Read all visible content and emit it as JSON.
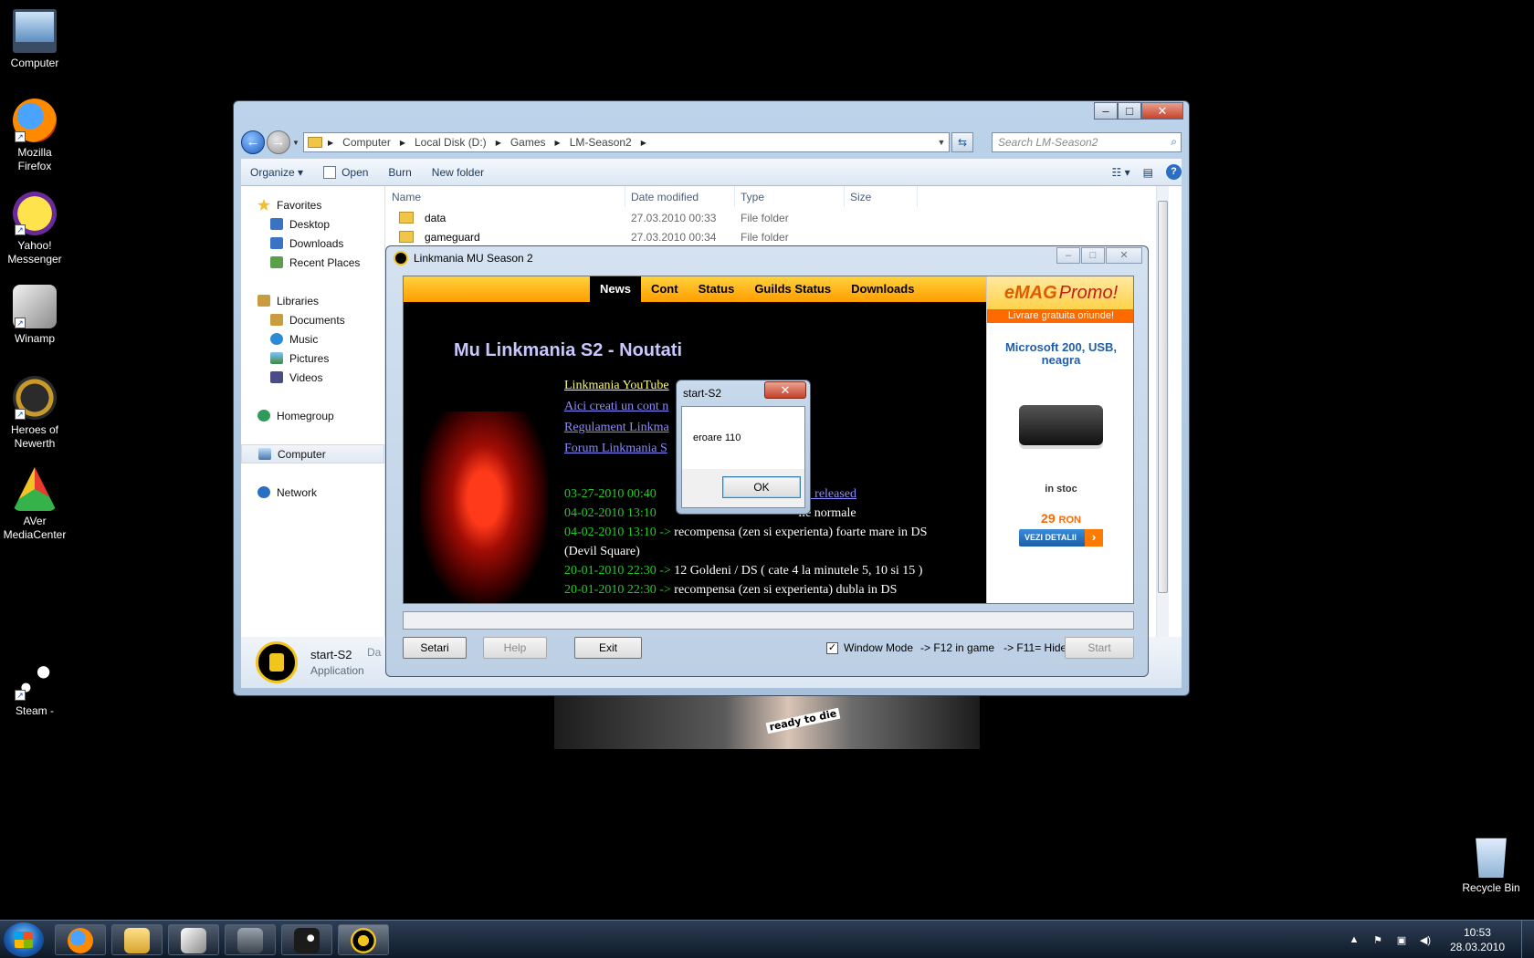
{
  "desktop": {
    "icons": [
      {
        "label": "Computer",
        "icon": "computer-icon"
      },
      {
        "label": "Mozilla Firefox",
        "icon": "firefox-icon"
      },
      {
        "label": "Yahoo! Messenger",
        "icon": "yahoo-messenger-icon"
      },
      {
        "label": "Winamp",
        "icon": "winamp-icon"
      },
      {
        "label": "Heroes of Newerth",
        "icon": "hon-icon"
      },
      {
        "label": "AVer MediaCenter",
        "icon": "aver-icon"
      },
      {
        "label": "Steam -",
        "icon": "steam-icon"
      },
      {
        "label": "Recycle Bin",
        "icon": "recycle-bin-icon"
      }
    ],
    "wallpaper_text": "ready to die"
  },
  "explorer": {
    "breadcrumb": [
      "Computer",
      "Local Disk (D:)",
      "Games",
      "LM-Season2"
    ],
    "search_placeholder": "Search LM-Season2",
    "toolbar": {
      "organize": "Organize",
      "open": "Open",
      "burn": "Burn",
      "new_folder": "New folder"
    },
    "nav": {
      "favorites": "Favorites",
      "desktop": "Desktop",
      "downloads": "Downloads",
      "recent": "Recent Places",
      "libraries": "Libraries",
      "documents": "Documents",
      "music": "Music",
      "pictures": "Pictures",
      "videos": "Videos",
      "homegroup": "Homegroup",
      "computer": "Computer",
      "network": "Network"
    },
    "columns": {
      "name": "Name",
      "date": "Date modified",
      "type": "Type",
      "size": "Size"
    },
    "files": [
      {
        "name": "data",
        "date": "27.03.2010 00:33",
        "type": "File folder"
      },
      {
        "name": "gameguard",
        "date": "27.03.2010 00:34",
        "type": "File folder"
      }
    ],
    "details": {
      "name": "start-S2",
      "type": "Application",
      "date_label": "Da"
    }
  },
  "launcher": {
    "title": "Linkmania MU Season 2",
    "nav": [
      "News",
      "Cont",
      "Status",
      "Guilds Status",
      "Downloads"
    ],
    "page_title": "Mu Linkmania S2 - Noutati",
    "links": [
      "Linkmania YouTube",
      "Aici creati un cont n",
      "Regulament Linkma",
      "Forum Linkmania S"
    ],
    "news": [
      {
        "date": "03-27-2010 00:40",
        "text": "",
        "link": "son2 released"
      },
      {
        "date": "04-02-2010 13:10",
        "text": "ile normale",
        "link": ""
      },
      {
        "date": "04-02-2010 13:10 ->",
        "text": "recompensa (zen si experienta) foarte mare in DS (Devil Square)",
        "link": ""
      },
      {
        "date": "20-01-2010 22:30 ->",
        "text": "12 Goldeni / DS ( cate 4 la minutele 5, 10 si 15 )",
        "link": ""
      },
      {
        "date": "20-01-2010 22:30 ->",
        "text": "recompensa (zen si experienta) dubla in DS",
        "link": ""
      }
    ],
    "ad": {
      "logo": "eMAG",
      "promo": "Promo!",
      "band": "Livrare gratuita oriunde!",
      "product": "Microsoft 200, USB, neagra",
      "stock": "in stoc",
      "price": "29",
      "currency": "RON",
      "button": "VEZI DETALII"
    },
    "buttons": {
      "setari": "Setari",
      "help": "Help",
      "exit": "Exit",
      "start": "Start"
    },
    "window_mode": "Window Mode",
    "hint1": "->  F12 in game",
    "hint2": "->  F11= Hide"
  },
  "dialog": {
    "title": "start-S2",
    "message": "eroare 110",
    "ok": "OK"
  },
  "taskbar": {
    "time": "10:53",
    "date": "28.03.2010"
  }
}
